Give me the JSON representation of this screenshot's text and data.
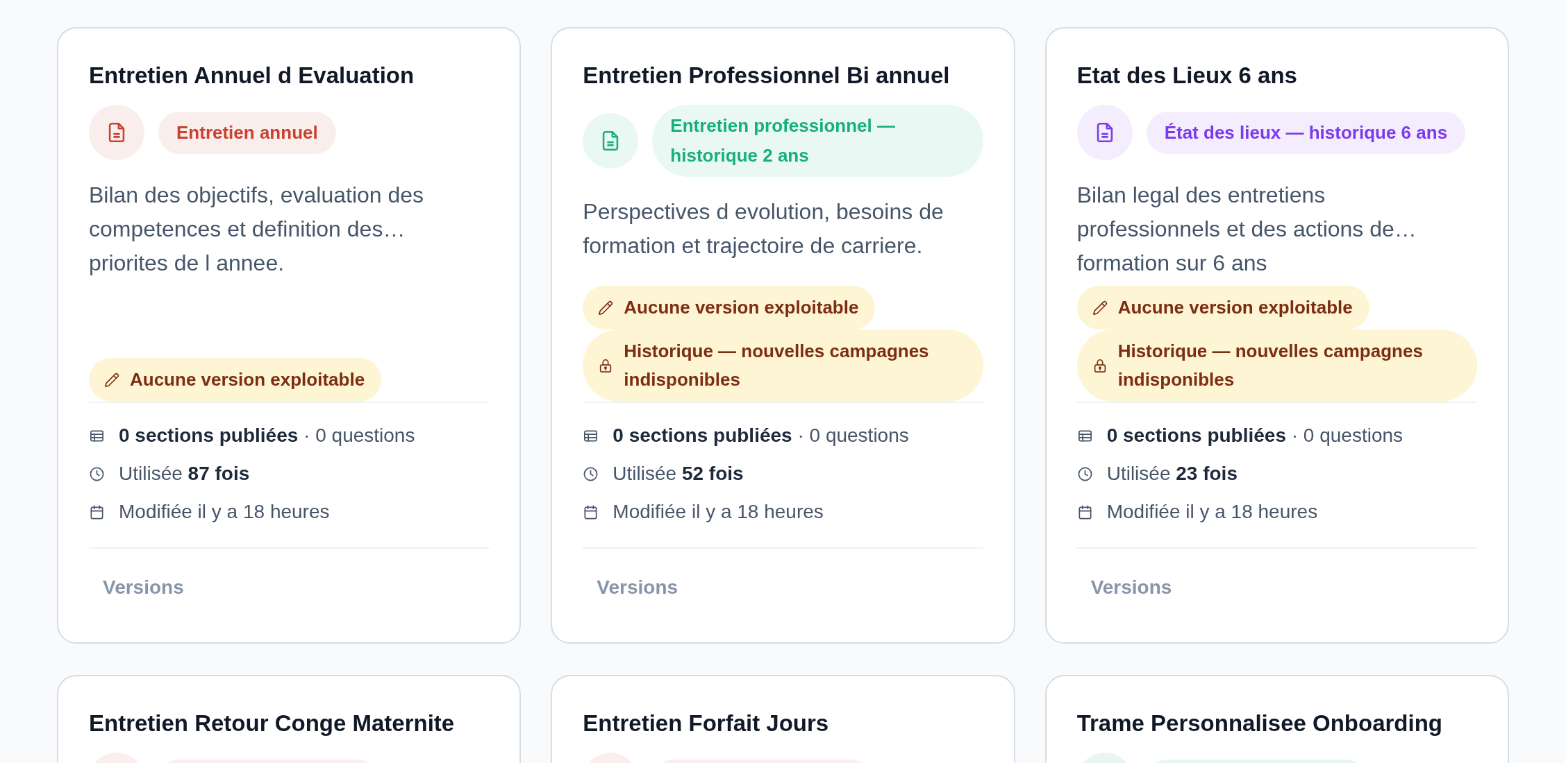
{
  "cards": [
    {
      "title": "Entretien Annuel d Evaluation",
      "tag": {
        "label": "Entretien annuel",
        "color": "#c9412f"
      },
      "description": "Bilan des objectifs, evaluation des\ncompetences et definition des…\npriorites de l annee.",
      "badges": [
        {
          "kind": "draft",
          "label": "Aucune version exploitable"
        }
      ],
      "meta": [
        {
          "kind": "sections",
          "text": "**0 sections publiées** · 0 questions"
        },
        {
          "kind": "usage",
          "text": "Utilisée **87 fois**"
        },
        {
          "kind": "modified",
          "text": "Modifiée il y a 18 heures"
        }
      ],
      "action": "Versions"
    },
    {
      "title": "Entretien Professionnel Bi annuel",
      "tag": {
        "label": "Entretien professionnel — historique 2 ans",
        "color": "#17b07a"
      },
      "description": "Perspectives d evolution, besoins de\nformation et trajectoire de carriere.",
      "badges": [
        {
          "kind": "draft",
          "label": "Aucune version exploitable"
        },
        {
          "kind": "locked",
          "label": "Historique — nouvelles campagnes indisponibles"
        }
      ],
      "meta": [
        {
          "kind": "sections",
          "text": "**0 sections publiées** · 0 questions"
        },
        {
          "kind": "usage",
          "text": "Utilisée **52 fois**"
        },
        {
          "kind": "modified",
          "text": "Modifiée il y a 18 heures"
        }
      ],
      "action": "Versions"
    },
    {
      "title": "Etat des Lieux 6 ans",
      "tag": {
        "label": "État des lieux — historique 6 ans",
        "color": "#7c3aed"
      },
      "description": "Bilan legal des entretiens\nprofessionnels et des actions de…\nformation sur 6 ans",
      "badges": [
        {
          "kind": "draft",
          "label": "Aucune version exploitable"
        },
        {
          "kind": "locked",
          "label": "Historique — nouvelles campagnes indisponibles"
        }
      ],
      "meta": [
        {
          "kind": "sections",
          "text": "**0 sections publiées** · 0 questions"
        },
        {
          "kind": "usage",
          "text": "Utilisée **23 fois**"
        },
        {
          "kind": "modified",
          "text": "Modifiée il y a 18 heures"
        }
      ],
      "action": "Versions"
    },
    {
      "title": "Entretien Retour Conge Maternite",
      "tag": {
        "color": "#fbefed"
      }
    },
    {
      "title": "Entretien Forfait Jours",
      "tag": {
        "color": "#fbefed"
      }
    },
    {
      "title": "Trame Personnalisee Onboarding",
      "tag": {
        "color": "#e7f6f0"
      }
    }
  ]
}
